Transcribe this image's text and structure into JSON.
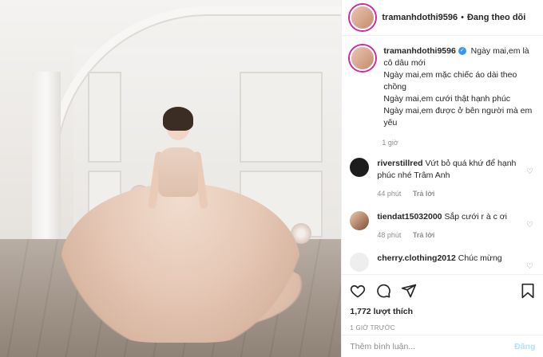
{
  "post": {
    "username": "tramanhdothi9596",
    "follow_status": "Đang theo dõi",
    "caption_lines": [
      "Ngày mai,em là cô dâu mới",
      "Ngày mai,em mặc chiếc áo dài theo chồng",
      "Ngày mai,em cưới thật hạnh phúc",
      "Ngày mai,em được ở bên người mà em yêu"
    ],
    "caption_time": "1 giờ",
    "likes": "1,772 lượt thích",
    "posted": "1 GIỜ TRƯỚC",
    "add_comment_placeholder": "Thêm bình luận...",
    "post_label": "Đăng"
  },
  "comments": [
    {
      "user": "riverstillred",
      "text": "Vứt bỏ quá khứ để hạnh phúc nhé Trâm Anh",
      "time": "44 phút",
      "reply": "Trả lời"
    },
    {
      "user": "tiendat15032000",
      "text": "Sắp cưới r à c ơi",
      "time": "48 phút",
      "reply": "Trả lời"
    },
    {
      "user": "cherry.clothing2012",
      "text": "Chúc mừng",
      "time": "",
      "reply": ""
    }
  ],
  "icons": [
    "heart-icon",
    "comment-icon",
    "share-icon",
    "bookmark-icon",
    "verified-icon"
  ],
  "colors": {
    "verified": "#3897f0",
    "muted": "#8e8e8e",
    "post_disabled": "#b2dffc"
  }
}
